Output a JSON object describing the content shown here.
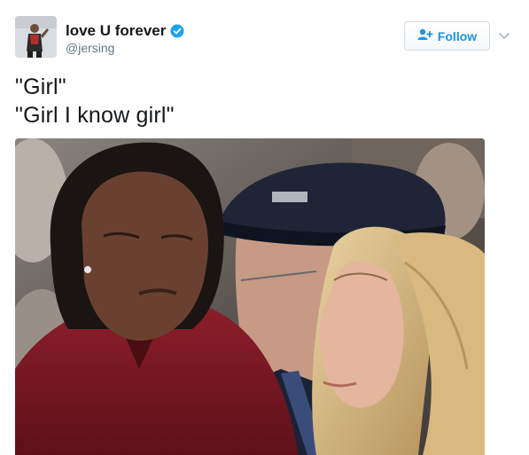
{
  "user": {
    "display_name": "love U forever",
    "handle": "@jersing",
    "verified": true,
    "avatar_icon": "avatar"
  },
  "follow_button": {
    "label": "Follow",
    "icon": "add-user-icon"
  },
  "menu_icon": "chevron-down-icon",
  "tweet": {
    "lines": [
      "\"Girl\"",
      "\"Girl I know girl\""
    ]
  },
  "colors": {
    "accent": "#1b95e0",
    "verified": "#1da1f2",
    "text": "#14171a",
    "secondary": "#657786"
  }
}
